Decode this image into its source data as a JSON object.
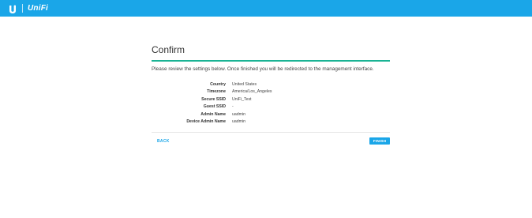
{
  "header": {
    "brand": "UniFi",
    "logo_icon": "ubiquiti-u-icon",
    "bar_color": "#1aa6e8"
  },
  "confirm": {
    "title": "Confirm",
    "description": "Please review the settings below. Once finished you will be redirected to the management interface.",
    "accent_color": "#1ab394",
    "settings": [
      {
        "label": "Country",
        "value": "United States"
      },
      {
        "label": "Timezone",
        "value": "America/Los_Angeles"
      },
      {
        "label": "Secure SSID",
        "value": "UniFi_Test"
      },
      {
        "label": "Guest SSID",
        "value": "-"
      },
      {
        "label": "Admin Name",
        "value": "uadmin"
      },
      {
        "label": "Device Admin Name",
        "value": "uadmin"
      }
    ],
    "back_label": "BACK",
    "finish_label": "FINISH"
  }
}
